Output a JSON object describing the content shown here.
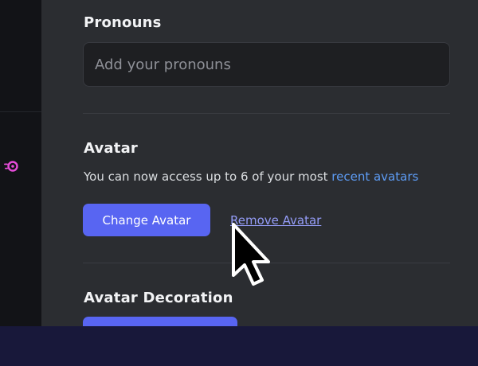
{
  "pronouns": {
    "title": "Pronouns",
    "placeholder": "Add your pronouns"
  },
  "avatar": {
    "title": "Avatar",
    "description_prefix": "You can now access up to 6 of your most ",
    "description_link": "recent avatars",
    "change_label": "Change Avatar",
    "remove_label": "Remove Avatar"
  },
  "avatar_decoration": {
    "title": "Avatar Decoration"
  },
  "colors": {
    "accent": "#5865f2",
    "link": "#5d9cf5",
    "nitro_icon": "#e64cd9",
    "background": "#2b2d31",
    "sidebar": "#121317"
  },
  "icons": {
    "sidebar_icon": "nitro-icon",
    "cursor": "mouse-cursor"
  }
}
